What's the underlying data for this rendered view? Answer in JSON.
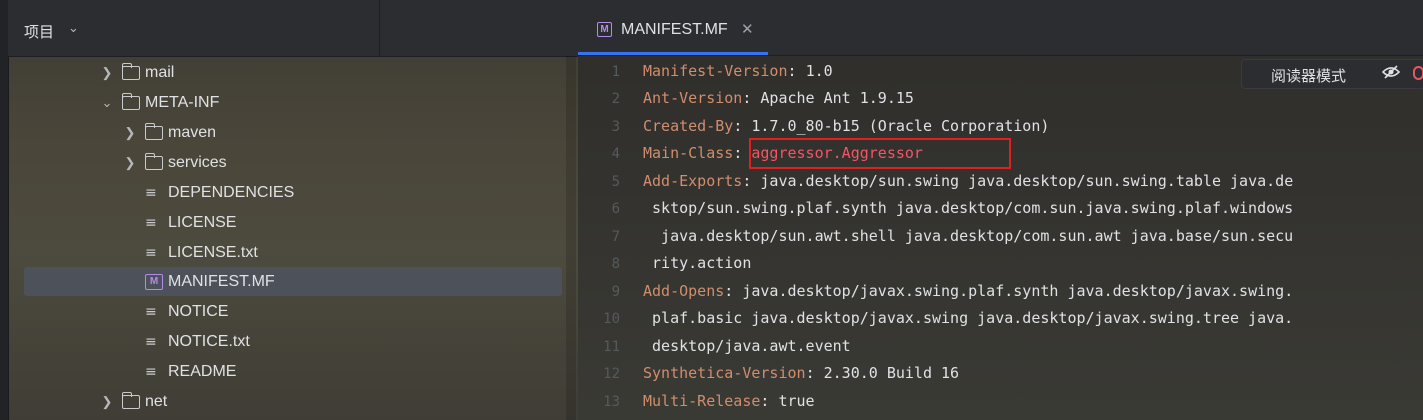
{
  "project_panel": {
    "title": "项目",
    "tree": [
      {
        "label": "mail",
        "type": "folder",
        "expanded": false
      },
      {
        "label": "META-INF",
        "type": "folder",
        "expanded": true
      },
      {
        "label": "maven",
        "type": "folder",
        "expanded": false
      },
      {
        "label": "services",
        "type": "folder",
        "expanded": false
      },
      {
        "label": "DEPENDENCIES",
        "type": "text-file"
      },
      {
        "label": "LICENSE",
        "type": "text-file"
      },
      {
        "label": "LICENSE.txt",
        "type": "text-file"
      },
      {
        "label": "MANIFEST.MF",
        "type": "manifest-file",
        "selected": true
      },
      {
        "label": "NOTICE",
        "type": "text-file"
      },
      {
        "label": "NOTICE.txt",
        "type": "text-file"
      },
      {
        "label": "README",
        "type": "text-file"
      },
      {
        "label": "net",
        "type": "folder",
        "expanded": false
      }
    ]
  },
  "editor": {
    "tab": {
      "label": "MANIFEST.MF",
      "icon": "M"
    },
    "reader_mode_label": "阅读器模式",
    "line_numbers": [
      "1",
      "2",
      "3",
      "4",
      "5",
      "6",
      "7",
      "8",
      "9",
      "10",
      "11",
      "12",
      "13"
    ],
    "lines": [
      {
        "key": "Manifest-Version",
        "sep": ": ",
        "value": "1.0"
      },
      {
        "key": "Ant-Version",
        "sep": ": ",
        "value": "Apache Ant 1.9.15"
      },
      {
        "key": "Created-By",
        "sep": ": ",
        "value": "1.7.0_80-b15 (Oracle Corporation)"
      },
      {
        "key": "Main-Class",
        "sep": ": ",
        "value": "aggressor.Aggressor"
      },
      {
        "key": "Add-Exports",
        "sep": ": ",
        "value": "java.desktop/sun.swing java.desktop/sun.swing.table java.de"
      },
      {
        "key": "",
        "sep": "",
        "value": " sktop/sun.swing.plaf.synth java.desktop/com.sun.java.swing.plaf.windows"
      },
      {
        "key": "",
        "sep": "",
        "value": "  java.desktop/sun.awt.shell java.desktop/com.sun.awt java.base/sun.secu"
      },
      {
        "key": "",
        "sep": "",
        "value": " rity.action"
      },
      {
        "key": "Add-Opens",
        "sep": ": ",
        "value": "java.desktop/javax.swing.plaf.synth java.desktop/javax.swing."
      },
      {
        "key": "",
        "sep": "",
        "value": " plaf.basic java.desktop/javax.swing java.desktop/javax.swing.tree java."
      },
      {
        "key": "",
        "sep": "",
        "value": " desktop/java.awt.event"
      },
      {
        "key": "Synthetica-Version",
        "sep": ": ",
        "value": "2.30.0 Build 16"
      },
      {
        "key": "Multi-Release",
        "sep": ": ",
        "value": "true"
      }
    ]
  },
  "colors": {
    "key": "#cf8e6d",
    "value": "#dfe1e5",
    "highlight": "#f75464",
    "annotation_box": "#e02020",
    "tab_underline": "#3574f0"
  }
}
